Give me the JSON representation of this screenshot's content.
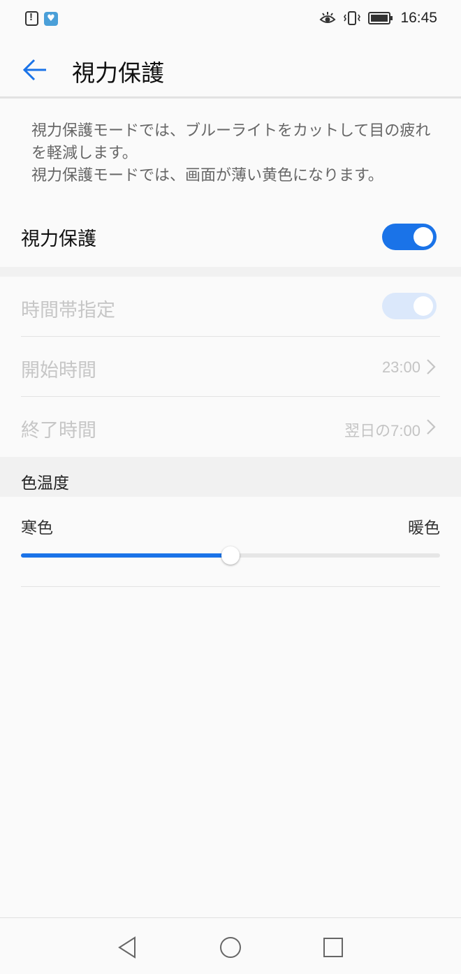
{
  "status_bar": {
    "time": "16:45",
    "left_icons": [
      "alert-icon",
      "health-app-icon"
    ],
    "right_icons": [
      "eye-comfort-icon",
      "vibrate-icon",
      "battery-icon"
    ]
  },
  "header": {
    "title": "視力保護",
    "back_icon": "arrow-left-icon"
  },
  "description": {
    "line1": "視力保護モードでは、ブルーライトをカットして目の疲れを軽減します。",
    "line2": "視力保護モードでは、画面が薄い黄色になります。"
  },
  "main_toggle": {
    "label": "視力保護",
    "on": true
  },
  "schedule": {
    "label": "時間帯指定",
    "on": true,
    "enabled": false,
    "start": {
      "label": "開始時間",
      "value": "23:00"
    },
    "end": {
      "label": "終了時間",
      "value": "翌日の7:00"
    }
  },
  "color_temperature": {
    "section_title": "色温度",
    "min_label": "寒色",
    "max_label": "暖色",
    "level": 0.5
  },
  "colors": {
    "accent": "#1a73e8",
    "toggle_disabled": "#dbe8fb",
    "disabled_text": "#c6c6c6"
  },
  "nav_bar": {
    "buttons": [
      "back-triangle-icon",
      "home-circle-icon",
      "recents-square-icon"
    ]
  }
}
